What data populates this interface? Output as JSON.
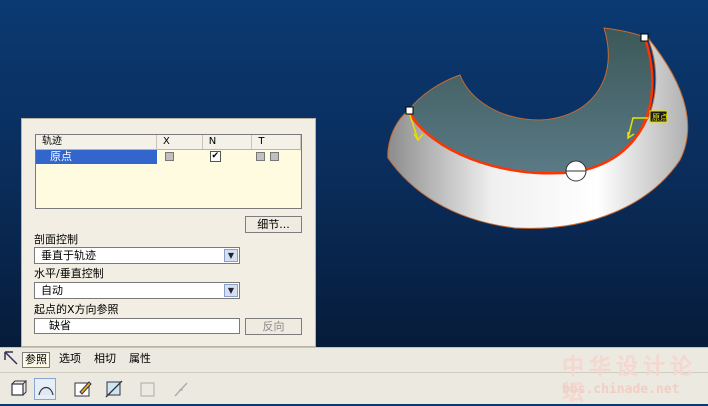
{
  "reference_table": {
    "headers": [
      "轨迹",
      "X",
      "N",
      "T"
    ],
    "rows": [
      {
        "name": "原点",
        "x_checked": false,
        "n_checked": true,
        "t_checked": false
      }
    ]
  },
  "buttons": {
    "details": "细节...",
    "flip": "反向"
  },
  "section_control": {
    "label": "剖面控制",
    "value": "垂直于轨迹"
  },
  "horiz_vert_control": {
    "label": "水平/垂直控制",
    "value": "自动"
  },
  "x_direction_ref": {
    "label": "起点的X方向参照",
    "value": "缺省"
  },
  "tabs": [
    "参照",
    "选项",
    "相切",
    "属性"
  ],
  "active_tab": "参照",
  "toolbar_icons": [
    "solid-icon",
    "surface-icon",
    "sketch-icon",
    "remove-material-icon",
    "thicken-icon",
    "trajectory-icon"
  ],
  "model_labels": {
    "origin_marker": "原点"
  },
  "watermark": {
    "title": "中华设计论坛",
    "url": "bbs.chinade.net"
  },
  "colors": {
    "viewport_top": "#0a3a72",
    "selection": "#3366cc",
    "trajectory": "#ff3300",
    "panel": "#f2eee3"
  }
}
